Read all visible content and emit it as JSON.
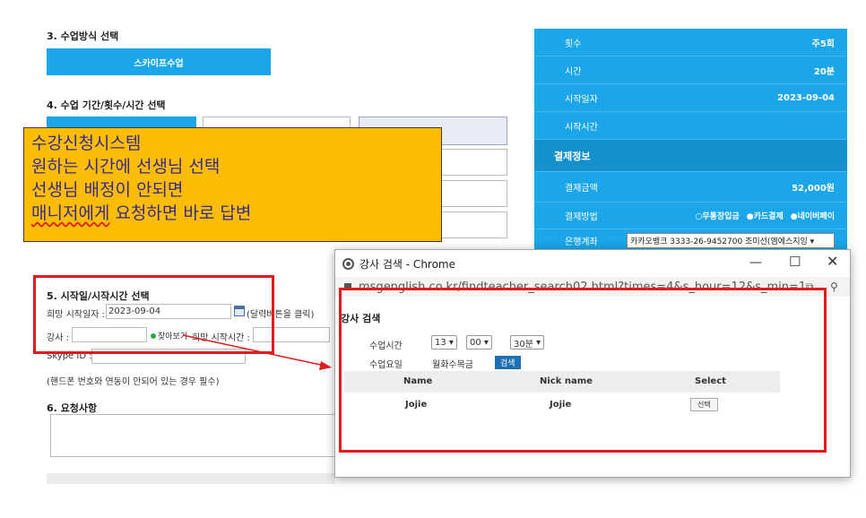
{
  "form": {
    "s3_title": "3. 수업방식 선택",
    "s3_button": "스카이프수업",
    "s4_title": "4. 수업 기간/횟수/시간 선택",
    "s5_title": "5. 시작일/시작시간 선택",
    "date_label": "희망 시작일자 :",
    "date_value": "2023-09-04",
    "date_hint": "(달력버튼을 클릭)",
    "teacher_label": "강사 :",
    "view_button": "찾아보기",
    "time_label": "희망 시작시간 :",
    "skype_label": "Skype ID :",
    "phone_note": "(핸드폰 번호와 연동이 안되어 있는 경우 필수)",
    "s6_title": "6. 요청사항"
  },
  "panel": {
    "rows": [
      {
        "label": "횟수",
        "value": "주5회"
      },
      {
        "label": "시간",
        "value": "20분"
      },
      {
        "label": "시작일자",
        "value": "2023-09-04"
      },
      {
        "label": "시작시간",
        "value": ""
      }
    ],
    "payment_header": "결제정보",
    "amount_label": "결제금액",
    "amount_value": "52,000원",
    "method_label": "결제방법",
    "methods": [
      "○무통장입금",
      "●카드결제",
      "●네이버페이"
    ],
    "bank_label": "은행계좌",
    "bank_value": "카카오뱅크 3333-26-9452700 조미선(엠에스지잉 ▾"
  },
  "note": {
    "line1": "수강신청시스템",
    "line2": "원하는 시간에 선생님 선택",
    "line3": "선생님 배정이 안되면",
    "line4a": "매니저에게",
    "line4b": " 요청하면 바로 답변"
  },
  "popup": {
    "title": "강사 검색 - Chrome",
    "url": "msgenglish.co.kr/findteacher_search02.html?times=4&s_hour=12&s_min=1&ck...",
    "heading": "강사 검색",
    "time_label": "수업시간",
    "hour": "13",
    "minute": "00",
    "duration": "30분",
    "day_label": "수업요일",
    "days": "월화수목금",
    "search_button": "검색",
    "columns": [
      "Name",
      "Nick name",
      "Select"
    ],
    "rows": [
      {
        "name": "Jojie",
        "nick": "Jojie",
        "select": "선택"
      }
    ]
  },
  "colors": {
    "accent": "#1aa6e8",
    "note_bg": "#fcbd00",
    "highlight": "#e11b1b"
  }
}
